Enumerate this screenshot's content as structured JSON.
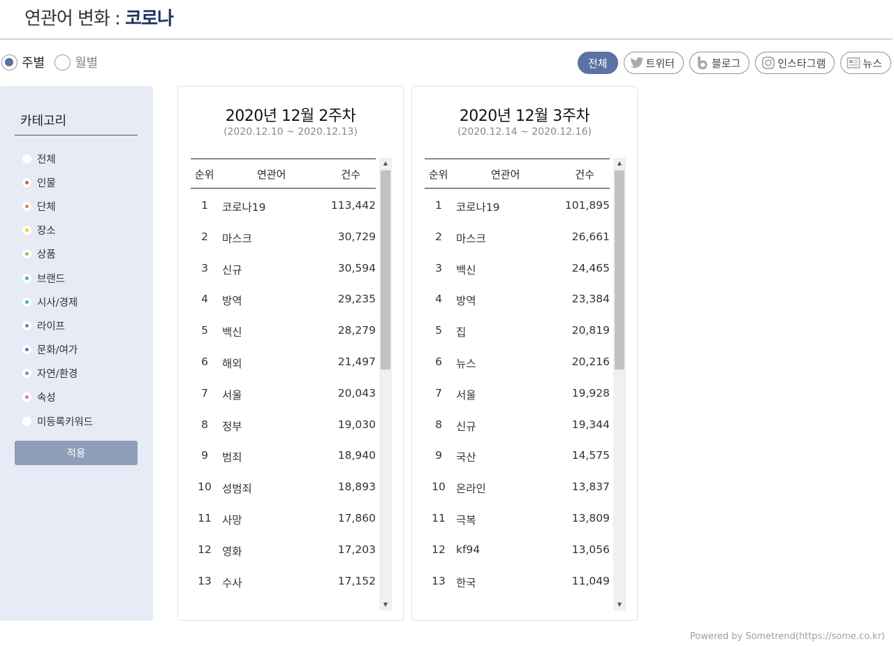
{
  "header": {
    "title_prefix": "연관어 변화 : ",
    "keyword": "코로나"
  },
  "period": {
    "options": [
      {
        "label": "주별",
        "selected": true
      },
      {
        "label": "월별",
        "selected": false
      }
    ]
  },
  "sources": [
    {
      "label": "전체",
      "icon": "",
      "active": true
    },
    {
      "label": "트위터",
      "icon": "twitter-icon",
      "active": false
    },
    {
      "label": "블로그",
      "icon": "blog-icon",
      "active": false
    },
    {
      "label": "인스타그램",
      "icon": "instagram-icon",
      "active": false
    },
    {
      "label": "뉴스",
      "icon": "news-icon",
      "active": false
    }
  ],
  "sidebar": {
    "title": "카테고리",
    "categories": [
      {
        "label": "전체",
        "color": ""
      },
      {
        "label": "인물",
        "color": "#d9534f"
      },
      {
        "label": "단체",
        "color": "#ef7a45"
      },
      {
        "label": "장소",
        "color": "#f5c82e"
      },
      {
        "label": "상품",
        "color": "#8cc152"
      },
      {
        "label": "브랜드",
        "color": "#37bc9b"
      },
      {
        "label": "시사/경제",
        "color": "#3bafda"
      },
      {
        "label": "라이프",
        "color": "#4a89dc"
      },
      {
        "label": "문화/여가",
        "color": "#656fd1"
      },
      {
        "label": "자연/환경",
        "color": "#967adc"
      },
      {
        "label": "속성",
        "color": "#d770ad"
      },
      {
        "label": "미등록키워드",
        "color": ""
      }
    ],
    "apply_label": "적용"
  },
  "columns": {
    "rank": "순위",
    "word": "연관어",
    "count": "건수"
  },
  "panels": [
    {
      "title": "2020년 12월 2주차",
      "range": "(2020.12.10 ~ 2020.12.13)",
      "rows": [
        {
          "rank": "1",
          "word": "코로나19",
          "count": "113,442"
        },
        {
          "rank": "2",
          "word": "마스크",
          "count": "30,729"
        },
        {
          "rank": "3",
          "word": "신규",
          "count": "30,594"
        },
        {
          "rank": "4",
          "word": "방역",
          "count": "29,235"
        },
        {
          "rank": "5",
          "word": "백신",
          "count": "28,279"
        },
        {
          "rank": "6",
          "word": "해외",
          "count": "21,497"
        },
        {
          "rank": "7",
          "word": "서울",
          "count": "20,043"
        },
        {
          "rank": "8",
          "word": "정부",
          "count": "19,030"
        },
        {
          "rank": "9",
          "word": "범죄",
          "count": "18,940"
        },
        {
          "rank": "10",
          "word": "성범죄",
          "count": "18,893"
        },
        {
          "rank": "11",
          "word": "사망",
          "count": "17,860"
        },
        {
          "rank": "12",
          "word": "영화",
          "count": "17,203"
        },
        {
          "rank": "13",
          "word": "수사",
          "count": "17,152"
        }
      ]
    },
    {
      "title": "2020년 12월 3주차",
      "range": "(2020.12.14 ~ 2020.12.16)",
      "rows": [
        {
          "rank": "1",
          "word": "코로나19",
          "count": "101,895"
        },
        {
          "rank": "2",
          "word": "마스크",
          "count": "26,661"
        },
        {
          "rank": "3",
          "word": "백신",
          "count": "24,465"
        },
        {
          "rank": "4",
          "word": "방역",
          "count": "23,384"
        },
        {
          "rank": "5",
          "word": "집",
          "count": "20,819"
        },
        {
          "rank": "6",
          "word": "뉴스",
          "count": "20,216"
        },
        {
          "rank": "7",
          "word": "서울",
          "count": "19,928"
        },
        {
          "rank": "8",
          "word": "신규",
          "count": "19,344"
        },
        {
          "rank": "9",
          "word": "국산",
          "count": "14,575"
        },
        {
          "rank": "10",
          "word": "온라인",
          "count": "13,837"
        },
        {
          "rank": "11",
          "word": "극복",
          "count": "13,809"
        },
        {
          "rank": "12",
          "word": "kf94",
          "count": "13,056"
        },
        {
          "rank": "13",
          "word": "한국",
          "count": "11,049"
        }
      ]
    }
  ],
  "footer": "Powered by Sometrend(https://some.co.kr)"
}
